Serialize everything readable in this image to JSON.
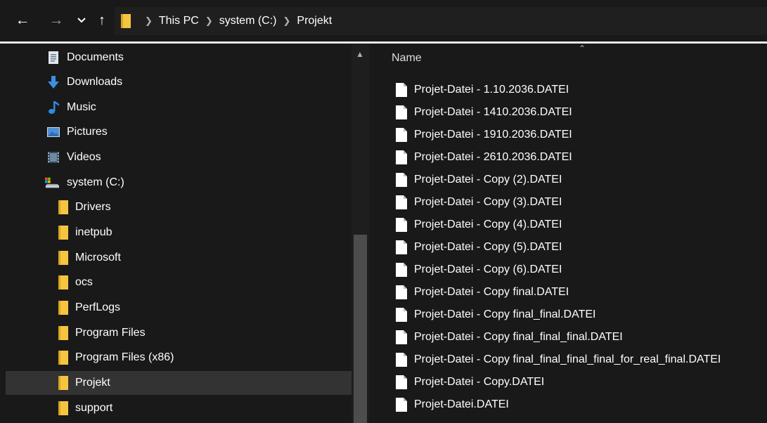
{
  "nav_buttons": {
    "back_icon": "arrow-left-icon",
    "forward_icon": "arrow-right-icon",
    "recent_icon": "chevron-down-icon",
    "up_icon": "arrow-up-icon"
  },
  "breadcrumb": [
    "This PC",
    "system (C:)",
    "Projekt"
  ],
  "sidebar": {
    "items": [
      {
        "label": "Documents",
        "icon": "documents-icon"
      },
      {
        "label": "Downloads",
        "icon": "downloads-icon"
      },
      {
        "label": "Music",
        "icon": "music-icon"
      },
      {
        "label": "Pictures",
        "icon": "pictures-icon"
      },
      {
        "label": "Videos",
        "icon": "videos-icon"
      },
      {
        "label": "system (C:)",
        "icon": "drive-icon"
      },
      {
        "label": "Drivers",
        "icon": "folder-icon"
      },
      {
        "label": "inetpub",
        "icon": "folder-icon"
      },
      {
        "label": "Microsoft",
        "icon": "folder-icon"
      },
      {
        "label": "ocs",
        "icon": "folder-icon"
      },
      {
        "label": "PerfLogs",
        "icon": "folder-icon"
      },
      {
        "label": "Program Files",
        "icon": "folder-icon"
      },
      {
        "label": "Program Files (x86)",
        "icon": "folder-icon"
      },
      {
        "label": "Projekt",
        "icon": "folder-icon",
        "selected": true
      },
      {
        "label": "support",
        "icon": "folder-icon"
      }
    ]
  },
  "filelist": {
    "column_header": "Name",
    "files": [
      "Projet-Datei - 1.10.2036.DATEI",
      "Projet-Datei - 1410.2036.DATEI",
      "Projet-Datei - 1910.2036.DATEI",
      "Projet-Datei - 2610.2036.DATEI",
      "Projet-Datei - Copy (2).DATEI",
      "Projet-Datei - Copy (3).DATEI",
      "Projet-Datei - Copy (4).DATEI",
      "Projet-Datei - Copy (5).DATEI",
      "Projet-Datei - Copy (6).DATEI",
      "Projet-Datei - Copy final.DATEI",
      "Projet-Datei - Copy final_final.DATEI",
      "Projet-Datei - Copy final_final_final.DATEI",
      "Projet-Datei - Copy final_final_final_final_for_real_final.DATEI",
      "Projet-Datei - Copy.DATEI",
      "Projet-Datei.DATEI"
    ]
  },
  "colors": {
    "background": "#191919",
    "selection": "#333333",
    "folder": "#f5c542",
    "accent_blue": "#3d8ee6"
  }
}
